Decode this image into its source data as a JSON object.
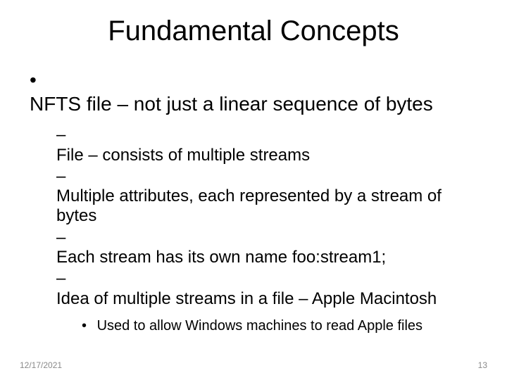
{
  "title": "Fundamental Concepts",
  "bullets": {
    "l1": "NFTS file – not just a linear sequence of bytes",
    "l2": [
      "File – consists of multiple streams",
      "Multiple attributes, each represented by a stream of bytes",
      "Each stream has its own name foo:stream1;",
      "Idea of multiple streams in a file – Apple Macintosh"
    ],
    "l3": "Used to allow Windows machines to read Apple files"
  },
  "footer": {
    "date": "12/17/2021",
    "page": "13"
  }
}
